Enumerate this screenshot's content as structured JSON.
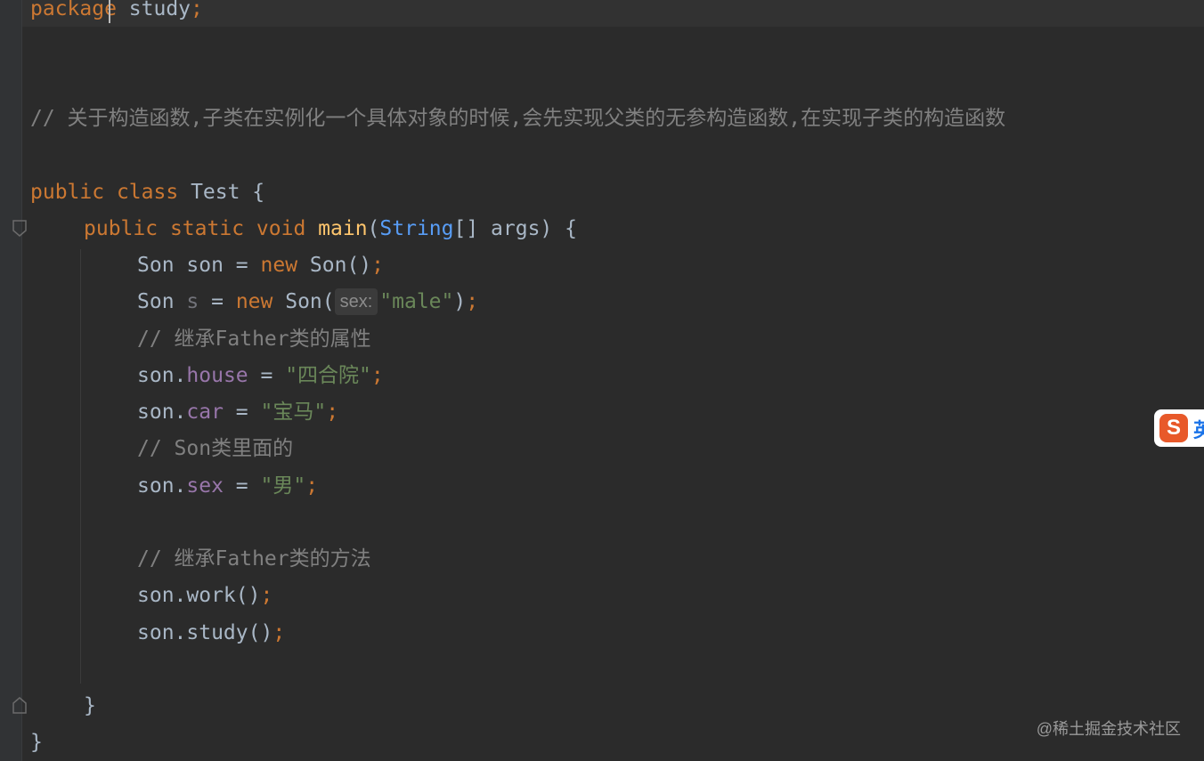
{
  "code": {
    "pkg_kw": "package",
    "pkg_name": "study",
    "header_comment": "// 关于构造函数,子类在实例化一个具体对象的时候,会先实现父类的无参构造函数,在实现子类的构造函数",
    "kw_public": "public",
    "kw_class": "class",
    "class_name": "Test",
    "kw_static": "static",
    "kw_void": "void",
    "method_name": "main",
    "param_type": "String",
    "param_rest": "[] args) {",
    "son_type": "Son",
    "var_son": "son",
    "var_s": "s",
    "kw_new": "new",
    "ctor_call": "Son()",
    "ctor_open": "Son(",
    "hint_label": "sex:",
    "str_male": "\"male\"",
    "comment_inherit_attr": "// 继承Father类的属性",
    "field_house": "house",
    "str_house": "\"四合院\"",
    "field_car": "car",
    "str_car": "\"宝马\"",
    "comment_son": "// Son类里面的",
    "field_sex": "sex",
    "str_sex": "\"男\"",
    "comment_inherit_method": "// 继承Father类的方法",
    "call_work": "son.work()",
    "call_study": "son.study()",
    "close_brace": "}"
  },
  "overlay": {
    "watermark": "@稀土掘金技术社区",
    "ime_logo": "S",
    "ime_text": "英"
  },
  "colors": {
    "background": "#2b2b2b",
    "keyword": "#cc7832",
    "method": "#ffc66d",
    "type": "#589df6",
    "field": "#9876aa",
    "string": "#6a8759",
    "comment": "#808080",
    "text": "#a9b7c6"
  }
}
